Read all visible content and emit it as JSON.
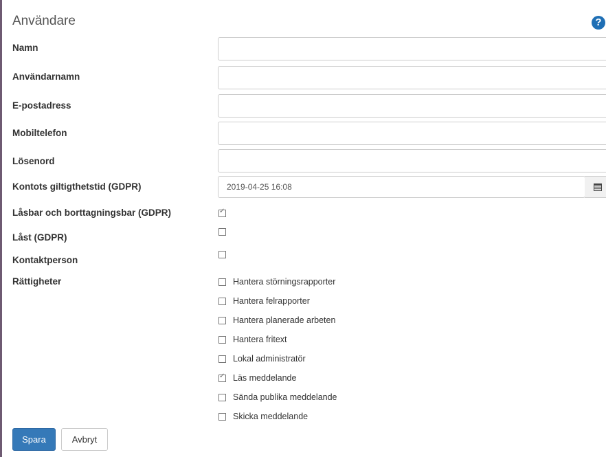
{
  "form": {
    "title": "Användare",
    "help_icon": "question-circle-icon",
    "fields": [
      {
        "label": "Namn",
        "value": ""
      },
      {
        "label": "Användarnamn",
        "value": ""
      },
      {
        "label": "E-postadress",
        "value": ""
      },
      {
        "label": "Mobiltelefon",
        "value": ""
      },
      {
        "label": "Lösenord",
        "value": ""
      }
    ],
    "expiry": {
      "label": "Kontots giltigthetstid (GDPR)",
      "value": "2019-04-25 16:08",
      "icon": "calendar-icon"
    },
    "lockable": {
      "label": "Låsbar och borttagningsbar (GDPR)",
      "checked": true
    },
    "locked": {
      "label": "Låst (GDPR)",
      "checked": false
    },
    "contact": {
      "label": "Kontaktperson",
      "checked": false
    },
    "rights": {
      "label": "Rättigheter",
      "options": [
        {
          "label": "Hantera störningsrapporter",
          "checked": false
        },
        {
          "label": "Hantera felrapporter",
          "checked": false
        },
        {
          "label": "Hantera planerade arbeten",
          "checked": false
        },
        {
          "label": "Hantera fritext",
          "checked": false
        },
        {
          "label": "Lokal administratör",
          "checked": false
        },
        {
          "label": "Läs meddelande",
          "checked": true
        },
        {
          "label": "Sända publika meddelande",
          "checked": false
        },
        {
          "label": "Skicka meddelande",
          "checked": false
        }
      ]
    },
    "buttons": {
      "save": "Spara",
      "cancel": "Avbryt"
    }
  },
  "colors": {
    "primary": "#3579b8",
    "help": "#1f6fb5",
    "sidebar": "#6e5a72"
  }
}
